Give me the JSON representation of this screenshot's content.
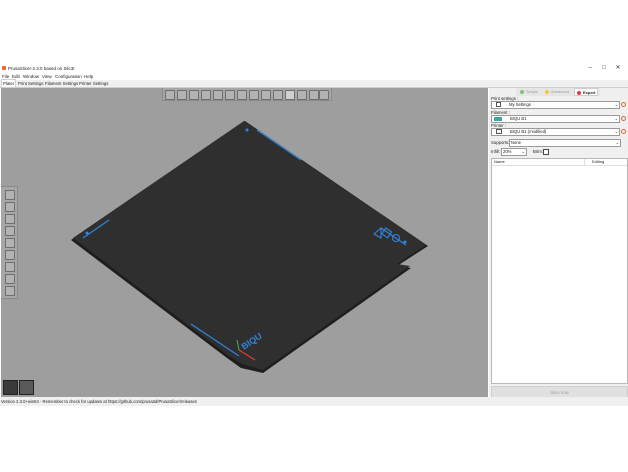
{
  "window": {
    "title": "PrusaSlicer-2.3.0 based on Slic3r",
    "controls": {
      "minimize": "–",
      "maximize": "□",
      "close": "✕"
    }
  },
  "menu": [
    "File",
    "Edit",
    "Window",
    "View",
    "Configuration",
    "Help"
  ],
  "tabs": [
    "Plater",
    "Print Settings",
    "Filament Settings",
    "Printer Settings"
  ],
  "active_tab": "Plater",
  "bed": {
    "logo": "BIQU",
    "colors": {
      "bed": "#2f2f2f",
      "edge": "#1e1e1e",
      "border_lines": "#2e86de",
      "viewport": "#9e9e9e"
    }
  },
  "sidebar": {
    "modes": [
      {
        "label": "Simple",
        "color": "#7cc576"
      },
      {
        "label": "Advanced",
        "color": "#f5c542"
      },
      {
        "label": "Expert",
        "color": "#e53935"
      }
    ],
    "active_mode": "Expert",
    "print_settings": {
      "label": "Print settings :",
      "value": "My Settings"
    },
    "filament": {
      "label": "Filament :",
      "value": "BIQU B1",
      "swatch": "#3aa8a0"
    },
    "printer": {
      "label": "Printer :",
      "value": "BIQU B1 (modified)"
    },
    "supports": {
      "label": "Supports:",
      "value": "None"
    },
    "infill": {
      "label": "Infill:",
      "value": "20%"
    },
    "brim": {
      "label": "Brim:",
      "checked": false
    },
    "object_list": {
      "col_name": "Name",
      "col_editing": "Editing"
    },
    "slice_button": "Slice now"
  },
  "status": "Version 2.3.0+win64 - Remember to check for updates at https://github.com/prusa3d/PrusaSlicer/releases"
}
